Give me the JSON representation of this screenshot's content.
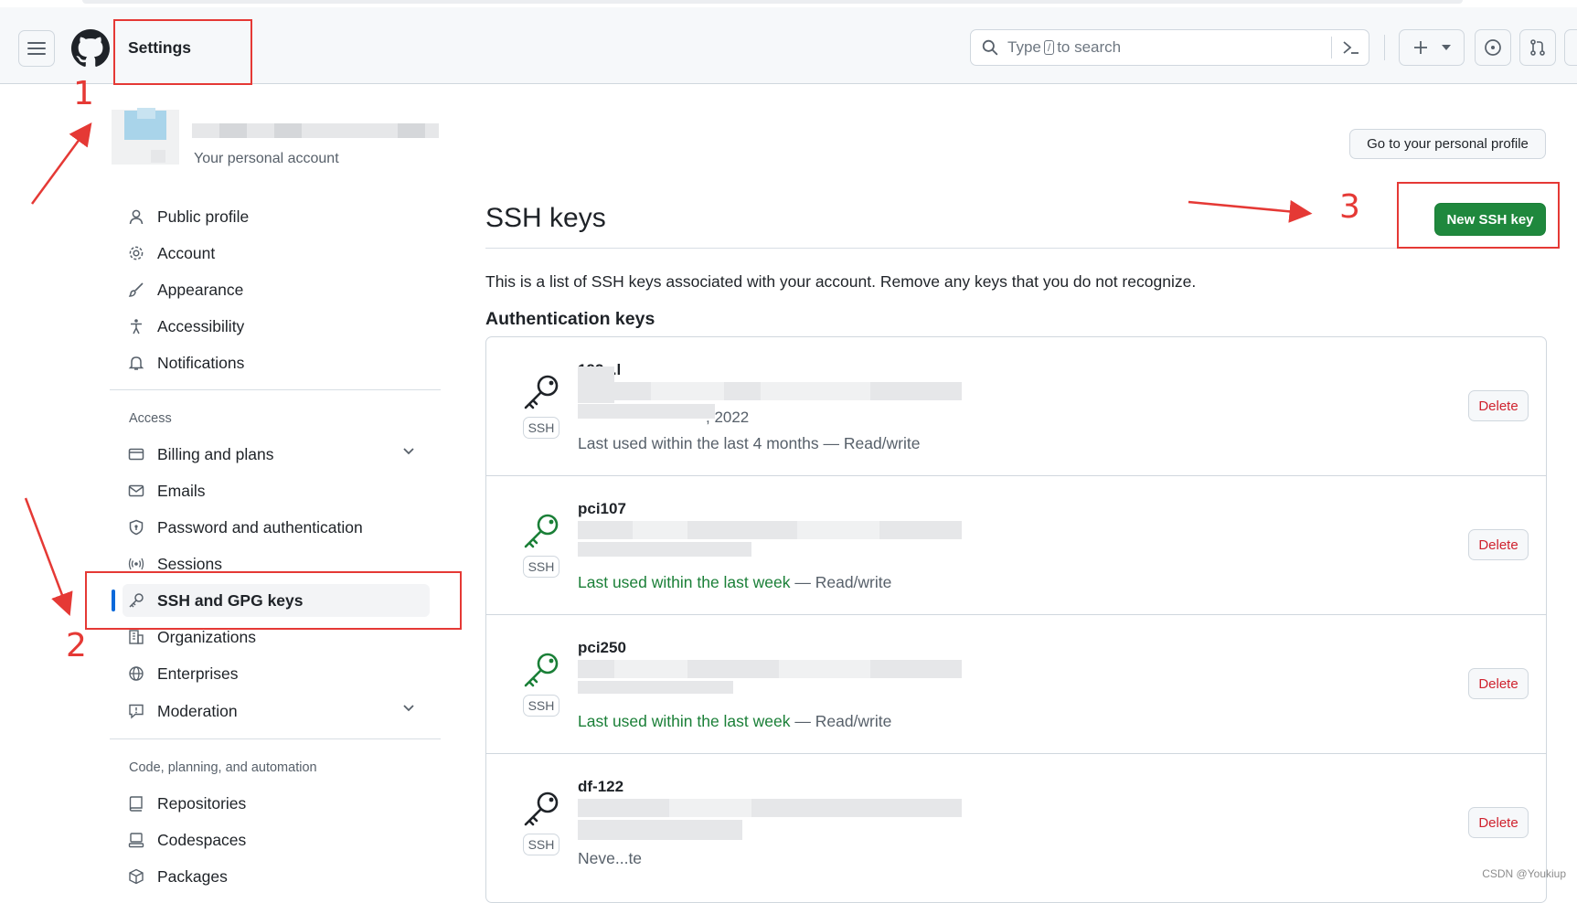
{
  "header": {
    "title": "Settings",
    "search_placeholder_pre": "Type",
    "search_key": "/",
    "search_placeholder_post": "to search"
  },
  "account": {
    "subtitle": "Your personal account",
    "profile_button": "Go to your personal profile"
  },
  "sidebar": {
    "items": [
      {
        "label": "Public profile"
      },
      {
        "label": "Account"
      },
      {
        "label": "Appearance"
      },
      {
        "label": "Accessibility"
      },
      {
        "label": "Notifications"
      }
    ],
    "access_heading": "Access",
    "access_items": [
      {
        "label": "Billing and plans"
      },
      {
        "label": "Emails"
      },
      {
        "label": "Password and authentication"
      },
      {
        "label": "Sessions"
      },
      {
        "label": "SSH and GPG keys"
      },
      {
        "label": "Organizations"
      },
      {
        "label": "Enterprises"
      },
      {
        "label": "Moderation"
      }
    ],
    "code_heading": "Code, planning, and automation",
    "code_items": [
      {
        "label": "Repositories"
      },
      {
        "label": "Codespaces"
      },
      {
        "label": "Packages"
      }
    ]
  },
  "main": {
    "title": "SSH keys",
    "new_key_button": "New SSH key",
    "description": "This is a list of SSH keys associated with your account. Remove any keys that you do not recognize.",
    "auth_heading": "Authentication keys",
    "keys": [
      {
        "title": "192...l",
        "date_suffix": ", 2022",
        "badge": "SSH",
        "used_highlight": "",
        "used_text": "Last used within the last 4 months — Read/write",
        "status": "inactive",
        "delete": "Delete"
      },
      {
        "title": "pci107",
        "date_suffix": "",
        "badge": "SSH",
        "used_highlight": "Last used within the last week",
        "used_text": " — Read/write",
        "status": "active",
        "delete": "Delete"
      },
      {
        "title": "pci250",
        "date_suffix": "",
        "badge": "SSH",
        "used_highlight": "Last used within the last week",
        "used_text": " — Read/write",
        "status": "active",
        "delete": "Delete"
      },
      {
        "title": "df-122",
        "date_suffix": "",
        "badge": "SSH",
        "used_highlight": "",
        "used_text": "Neve...te",
        "status": "inactive",
        "delete": "Delete"
      }
    ]
  },
  "annotations": {
    "label_1": "1",
    "label_2": "2",
    "label_3": "3",
    "color": "#e53935"
  },
  "watermark": "CSDN @Youkiup",
  "colors": {
    "primary_button": "#1f883d",
    "active_key_icon": "#1a7f37",
    "delete_text": "#cf222e",
    "nav_active_marker": "#0969da"
  }
}
